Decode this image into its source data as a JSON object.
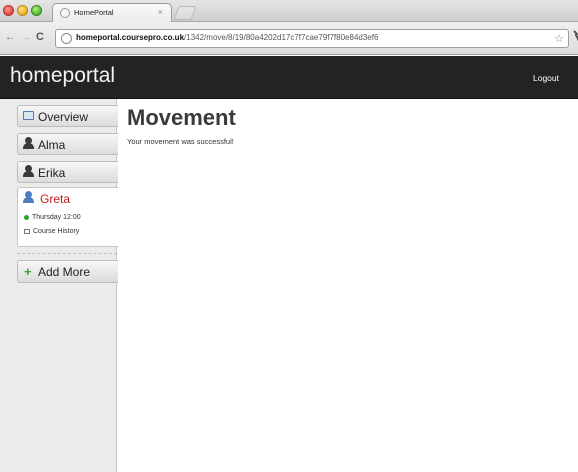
{
  "browser": {
    "tab_title": "HomePortal",
    "tab_close": "×",
    "url_host": "homeportal.coursepro.co.uk",
    "url_path": "/1342/move/8/19/80a4202d17c7f7cae79f7f80e84d3ef6",
    "nav_back": "←",
    "nav_forward": "→",
    "nav_reload": "C",
    "star": "☆"
  },
  "header": {
    "brand": "homeportal",
    "logout_label": "Logout"
  },
  "sidebar": {
    "items": [
      {
        "label": "Overview",
        "icon": "overview-icon"
      },
      {
        "label": "Alma",
        "icon": "person-icon"
      },
      {
        "label": "Erika",
        "icon": "person-icon"
      }
    ],
    "selected": {
      "label": "Greta",
      "icon": "person-icon",
      "sub_items": [
        {
          "label": "Thursday 12:00",
          "icon": "green-dot-icon"
        },
        {
          "label": "Course History",
          "icon": "history-icon"
        }
      ]
    },
    "add_more_label": "Add More",
    "add_more_icon": "+"
  },
  "content": {
    "title": "Movement",
    "message": "Your movement was successful!"
  },
  "colors": {
    "header_bg": "#232323",
    "selected_name": "#c31b1b",
    "add_plus": "#3da236"
  }
}
